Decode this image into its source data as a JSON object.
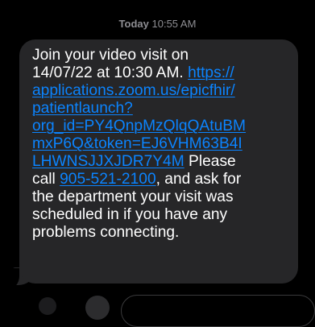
{
  "header": {
    "day": "Today",
    "time": "10:55 AM"
  },
  "message": {
    "lines": [
      {
        "segments": [
          {
            "text": "Join your video visit on",
            "type": "plain"
          }
        ]
      },
      {
        "segments": [
          {
            "text": "14/07/22 at 10:30 AM. ",
            "type": "plain"
          },
          {
            "text": "https://",
            "type": "link"
          }
        ]
      },
      {
        "segments": [
          {
            "text": "applications.zoom.us/epicfhir/",
            "type": "link"
          }
        ]
      },
      {
        "segments": [
          {
            "text": "patientlaunch?",
            "type": "link"
          }
        ]
      },
      {
        "segments": [
          {
            "text": "org_id=PY4QnpMzQlqQAtuBM",
            "type": "link"
          }
        ]
      },
      {
        "segments": [
          {
            "text": "mxP6Q&token=EJ6VHM63B4I",
            "type": "link"
          }
        ]
      },
      {
        "segments": [
          {
            "text": "LHWNSJJXJDR7Y4M",
            "type": "link"
          },
          {
            "text": " Please",
            "type": "plain"
          }
        ]
      },
      {
        "segments": [
          {
            "text": "call ",
            "type": "plain"
          },
          {
            "text": "905-521-2100",
            "type": "phone"
          },
          {
            "text": ", and ask for",
            "type": "plain"
          }
        ]
      },
      {
        "segments": [
          {
            "text": "the department your visit was",
            "type": "plain"
          }
        ]
      },
      {
        "segments": [
          {
            "text": "scheduled in if you have any",
            "type": "plain"
          }
        ]
      },
      {
        "segments": [
          {
            "text": "problems connecting.",
            "type": "plain"
          }
        ]
      }
    ]
  },
  "colors": {
    "background": "#000000",
    "bubble": "#262628",
    "text": "#ffffff",
    "link": "#0b84ff",
    "timestamp": "#8e8e93"
  }
}
